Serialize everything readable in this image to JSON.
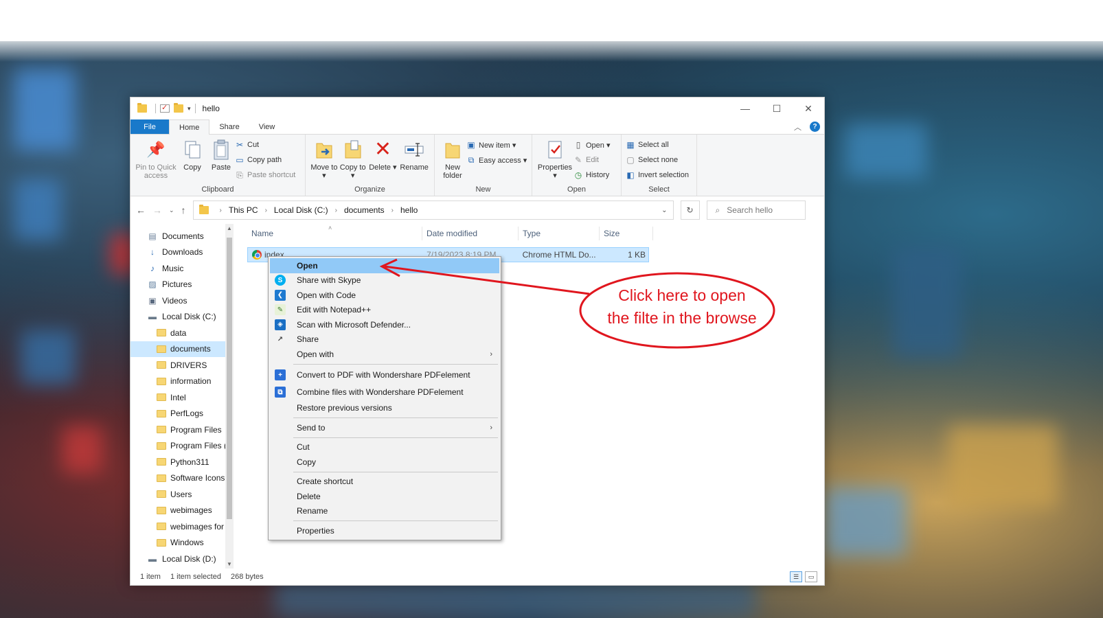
{
  "window": {
    "title": "hello",
    "controls": {
      "minimize": "—",
      "maximize": "☐",
      "close": "✕"
    }
  },
  "ribbon_tabs": [
    "File",
    "Home",
    "Share",
    "View"
  ],
  "ribbon": {
    "clipboard": {
      "label": "Clipboard",
      "pin": "Pin to Quick access",
      "copy": "Copy",
      "paste": "Paste",
      "cut": "Cut",
      "copy_path": "Copy path",
      "paste_shortcut": "Paste shortcut"
    },
    "organize": {
      "label": "Organize",
      "move_to": "Move to ▾",
      "copy_to": "Copy to ▾",
      "delete": "Delete ▾",
      "rename": "Rename"
    },
    "new": {
      "label": "New",
      "new_folder": "New folder",
      "new_item": "New item ▾",
      "easy_access": "Easy access ▾"
    },
    "open": {
      "label": "Open",
      "properties": "Properties ▾",
      "open": "Open ▾",
      "edit": "Edit",
      "history": "History"
    },
    "select": {
      "label": "Select",
      "select_all": "Select all",
      "select_none": "Select none",
      "invert": "Invert selection"
    }
  },
  "address": {
    "crumbs": [
      "This PC",
      "Local Disk (C:)",
      "documents",
      "hello"
    ],
    "search_placeholder": "Search hello"
  },
  "nav_items": [
    {
      "label": "Documents",
      "icon": "documents-icon",
      "level": 1
    },
    {
      "label": "Downloads",
      "icon": "download-icon",
      "level": 1
    },
    {
      "label": "Music",
      "icon": "music-icon",
      "level": 1
    },
    {
      "label": "Pictures",
      "icon": "pictures-icon",
      "level": 1
    },
    {
      "label": "Videos",
      "icon": "videos-icon",
      "level": 1
    },
    {
      "label": "Local Disk (C:)",
      "icon": "drive-icon",
      "level": 1
    },
    {
      "label": "data",
      "icon": "folder-icon",
      "level": 2
    },
    {
      "label": "documents",
      "icon": "folder-icon",
      "level": 2,
      "selected": true
    },
    {
      "label": "DRIVERS",
      "icon": "folder-icon",
      "level": 2
    },
    {
      "label": "information",
      "icon": "folder-icon",
      "level": 2
    },
    {
      "label": "Intel",
      "icon": "folder-icon",
      "level": 2
    },
    {
      "label": "PerfLogs",
      "icon": "folder-icon",
      "level": 2
    },
    {
      "label": "Program Files",
      "icon": "folder-icon",
      "level": 2
    },
    {
      "label": "Program Files (",
      "icon": "folder-icon",
      "level": 2
    },
    {
      "label": "Python311",
      "icon": "folder-icon",
      "level": 2
    },
    {
      "label": "Software Icons",
      "icon": "folder-icon",
      "level": 2
    },
    {
      "label": "Users",
      "icon": "folder-icon",
      "level": 2
    },
    {
      "label": "webimages",
      "icon": "folder-icon",
      "level": 2
    },
    {
      "label": "webimages for",
      "icon": "folder-icon",
      "level": 2
    },
    {
      "label": "Windows",
      "icon": "folder-icon",
      "level": 2
    },
    {
      "label": "Local Disk (D:)",
      "icon": "drive-icon",
      "level": 1
    }
  ],
  "columns": [
    "Name",
    "Date modified",
    "Type",
    "Size"
  ],
  "files": [
    {
      "name": "index",
      "date": "7/19/2023 8:19 PM",
      "type": "Chrome HTML Do...",
      "size": "1 KB",
      "icon": "chrome-icon"
    }
  ],
  "context_menu": [
    {
      "label": "Open",
      "icon": "",
      "selected": true,
      "bold": true
    },
    {
      "label": "Share with Skype",
      "icon": "skype-icon"
    },
    {
      "label": "Open with Code",
      "icon": "vscode-icon"
    },
    {
      "label": "Edit with Notepad++",
      "icon": "notepadpp-icon"
    },
    {
      "label": "Scan with Microsoft Defender...",
      "icon": "defender-icon"
    },
    {
      "label": "Share",
      "icon": "share-icon"
    },
    {
      "label": "Open with",
      "icon": "",
      "submenu": true
    },
    {
      "separator": true
    },
    {
      "label": "Convert to PDF with Wondershare PDFelement",
      "icon": "pdfelement-icon",
      "tall": true
    },
    {
      "label": "Combine files with Wondershare PDFelement",
      "icon": "pdfelement-combine-icon",
      "tall": true
    },
    {
      "label": "Restore previous versions",
      "icon": ""
    },
    {
      "separator": true
    },
    {
      "label": "Send to",
      "icon": "",
      "submenu": true
    },
    {
      "separator": true
    },
    {
      "label": "Cut",
      "icon": ""
    },
    {
      "label": "Copy",
      "icon": ""
    },
    {
      "separator": true
    },
    {
      "label": "Create shortcut",
      "icon": ""
    },
    {
      "label": "Delete",
      "icon": ""
    },
    {
      "label": "Rename",
      "icon": ""
    },
    {
      "separator": true
    },
    {
      "label": "Properties",
      "icon": ""
    }
  ],
  "status": {
    "items": "1 item",
    "selected": "1 item selected",
    "size": "268 bytes"
  },
  "annotation": {
    "line1": "Click here to open",
    "line2": "the filte in the browse",
    "color": "#e0161e"
  },
  "colors": {
    "accent": "#1979ca",
    "selection": "#cce8ff",
    "menu_highlight": "#91c9f7"
  }
}
